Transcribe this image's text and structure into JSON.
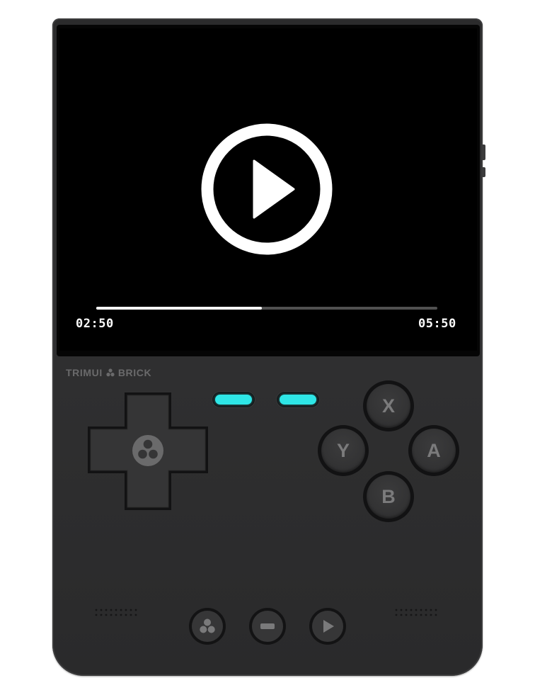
{
  "player": {
    "state": "paused",
    "elapsed": "02:50",
    "duration": "05:50",
    "progress_fraction": 0.486
  },
  "device": {
    "brand_left": "TRIMUI",
    "brand_right": "BRICK"
  },
  "buttons": {
    "x": "X",
    "y": "Y",
    "a": "A",
    "b": "B"
  },
  "icons": {
    "play": "play-icon",
    "brand_logo": "trimui-logo-icon",
    "menu": "trimui-logo-icon",
    "select": "minus-icon",
    "start": "play-triangle-icon"
  },
  "colors": {
    "body": "#2e2e2f",
    "screen": "#000000",
    "led": "#2ee6e6",
    "progress_fill": "#ffffff",
    "progress_track": "#505050",
    "button_label": "#7b7b7c"
  }
}
